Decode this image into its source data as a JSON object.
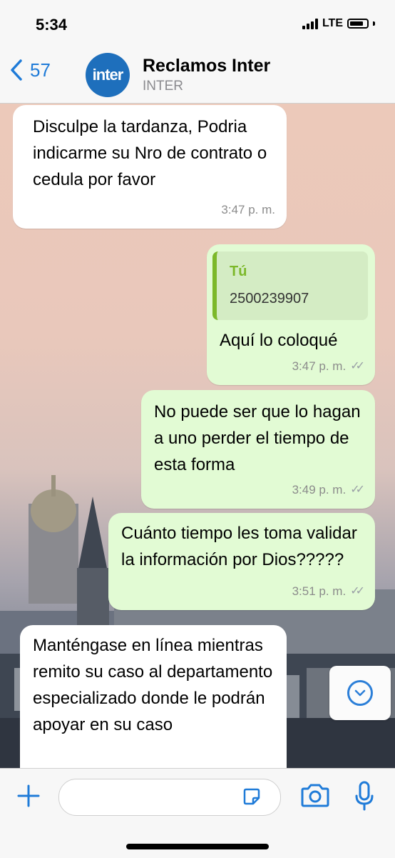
{
  "status": {
    "time": "5:34",
    "network": "LTE"
  },
  "header": {
    "back_count": "57",
    "avatar_text": "inter",
    "name": "Reclamos Inter",
    "subtitle": "INTER"
  },
  "messages": [
    {
      "direction": "in",
      "text": "Disculpe la tardanza, Podria indicarme su Nro de contrato o cedula por favor",
      "time": "3:47 p. m."
    },
    {
      "direction": "out",
      "quote_author": "Tú",
      "quote_text": "2500239907",
      "text": "Aquí lo coloqué",
      "time": "3:47 p. m."
    },
    {
      "direction": "out",
      "text": "No puede ser que lo hagan a uno perder el tiempo de esta forma",
      "time": "3:49 p. m."
    },
    {
      "direction": "out",
      "text": "Cuánto tiempo les toma validar la información por Dios?????",
      "time": "3:51 p. m."
    },
    {
      "direction": "in",
      "text": "Manténgase en línea mientras remito su caso al departamento especializado donde le podrán apoyar en su caso"
    }
  ],
  "colors": {
    "accent": "#1f7bd8",
    "outgoing": "#e2fbd4",
    "incoming": "#ffffff",
    "quote_bar": "#7cb82a"
  },
  "icons": [
    "back-chevron-icon",
    "scroll-down-icon",
    "plus-icon",
    "sticker-icon",
    "camera-icon",
    "microphone-icon"
  ]
}
